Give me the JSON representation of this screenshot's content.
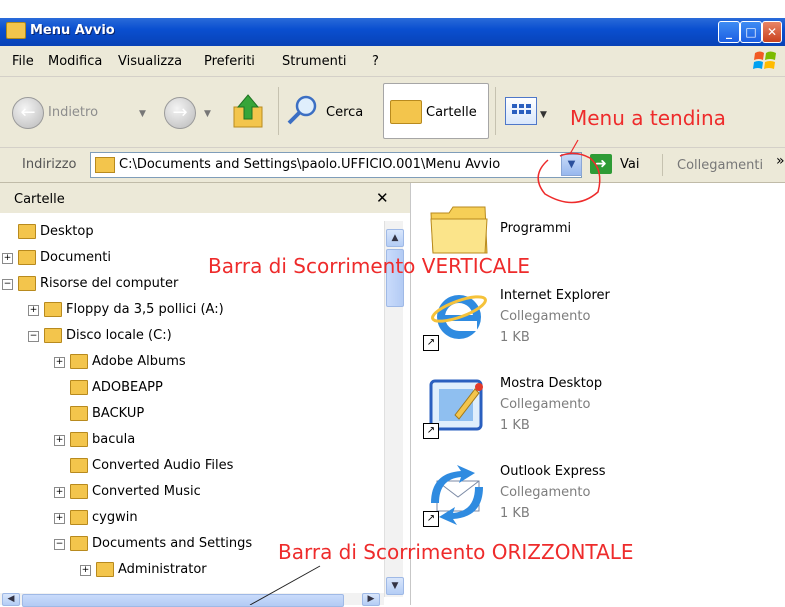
{
  "window": {
    "title": "Menu Avvio",
    "controls": [
      "_",
      "□",
      "✕"
    ]
  },
  "menubar": {
    "items": [
      "File",
      "Modifica",
      "Visualizza",
      "Preferiti",
      "Strumenti",
      "?"
    ]
  },
  "toolbar": {
    "back_label": "Indietro",
    "search_label": "Cerca",
    "folders_label": "Cartelle"
  },
  "address": {
    "label": "Indirizzo",
    "value": "C:\\Documents and Settings\\paolo.UFFICIO.001\\Menu Avvio",
    "go_label": "Vai",
    "links_label": "Collegamenti",
    "links_arrow": "»"
  },
  "folders_pane": {
    "title": "Cartelle",
    "close": "✕",
    "tree": [
      {
        "label": "Desktop",
        "level": 0,
        "expander": ""
      },
      {
        "label": "Documenti",
        "level": 0,
        "expander": "+"
      },
      {
        "label": "Risorse del computer",
        "level": 0,
        "expander": "−"
      },
      {
        "label": "Floppy da 3,5 pollici (A:)",
        "level": 1,
        "expander": "+"
      },
      {
        "label": "Disco locale (C:)",
        "level": 1,
        "expander": "−"
      },
      {
        "label": "Adobe Albums",
        "level": 2,
        "expander": "+"
      },
      {
        "label": "ADOBEAPP",
        "level": 2,
        "expander": ""
      },
      {
        "label": "BACKUP",
        "level": 2,
        "expander": ""
      },
      {
        "label": "bacula",
        "level": 2,
        "expander": "+"
      },
      {
        "label": "Converted Audio Files",
        "level": 2,
        "expander": ""
      },
      {
        "label": "Converted Music",
        "level": 2,
        "expander": "+"
      },
      {
        "label": "cygwin",
        "level": 2,
        "expander": "+"
      },
      {
        "label": "Documents and Settings",
        "level": 2,
        "expander": "−"
      },
      {
        "label": "Administrator",
        "level": 3,
        "expander": "+"
      }
    ]
  },
  "content": {
    "items": [
      {
        "name": "Programmi",
        "type": "",
        "size": ""
      },
      {
        "name": "Internet Explorer",
        "type": "Collegamento",
        "size": "1 KB"
      },
      {
        "name": "Mostra Desktop",
        "type": "Collegamento",
        "size": "1 KB"
      },
      {
        "name": "Outlook Express",
        "type": "Collegamento",
        "size": "1 KB"
      }
    ]
  },
  "annotations": {
    "dropdown": "Menu a tendina",
    "vertical": "Barra di Scorrimento VERTICALE",
    "horizontal": "Barra di Scorrimento ORIZZONTALE"
  },
  "colors": {
    "title_bar": "#0a4fd0",
    "annotation": "#ee2b2b",
    "chrome": "#ece9d8"
  }
}
